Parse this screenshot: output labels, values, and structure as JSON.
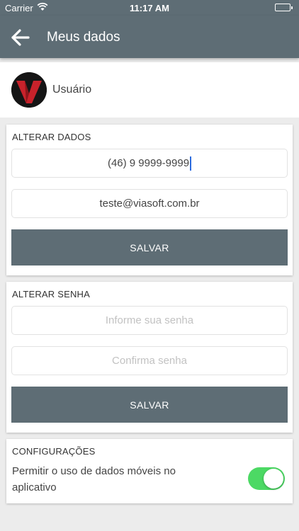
{
  "status_bar": {
    "carrier": "Carrier",
    "time": "11:17 AM"
  },
  "navbar": {
    "title": "Meus dados",
    "back_icon": "arrow-left-icon"
  },
  "profile": {
    "name": "Usuário"
  },
  "alterar_dados": {
    "title": "ALTERAR DADOS",
    "phone_value": "(46) 9 9999-9999",
    "email_value": "teste@viasoft.com.br",
    "save_label": "SALVAR"
  },
  "alterar_senha": {
    "title": "ALTERAR SENHA",
    "password_placeholder": "Informe sua senha",
    "confirm_placeholder": "Confirma senha",
    "save_label": "SALVAR"
  },
  "configuracoes": {
    "title": "CONFIGURAÇÕES",
    "mobile_data_label": "Permitir o uso de dados móveis no aplicativo",
    "mobile_data_enabled": true
  },
  "colors": {
    "header": "#5e6d75",
    "toggle_on": "#4cd964",
    "button": "#5e6d75"
  }
}
